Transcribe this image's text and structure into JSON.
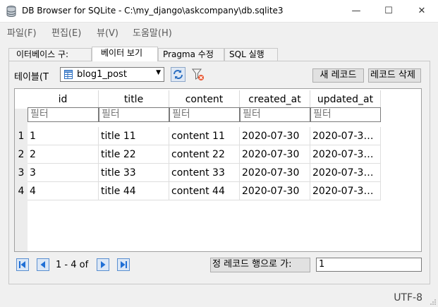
{
  "window": {
    "title": "DB Browser for SQLite - C:\\my_django\\askcompany\\db.sqlite3",
    "minimize": "—",
    "maximize": "☐",
    "close": "✕"
  },
  "menu": [
    "파일(F)",
    "편집(E)",
    "뷰(V)",
    "도움말(H)"
  ],
  "tabs": [
    "이터베이스 구:",
    "베이터 보기",
    "Pragma 수정",
    "SQL 실행"
  ],
  "browse": {
    "table_label": "테이블(T",
    "table_value": "blog1_post",
    "new_record": "새 레코드",
    "delete_record": "레코드 삭제",
    "columns": [
      "id",
      "title",
      "content",
      "created_at",
      "updated_at"
    ],
    "filter_placeholder": "필터",
    "rows": [
      {
        "num": "1",
        "cells": [
          "1",
          "title 11",
          "content 11",
          "2020-07-30",
          "2020-07-3…"
        ]
      },
      {
        "num": "2",
        "cells": [
          "2",
          "title 22",
          "content 22",
          "2020-07-30",
          "2020-07-3…"
        ]
      },
      {
        "num": "3",
        "cells": [
          "3",
          "title 33",
          "content 33",
          "2020-07-30",
          "2020-07-3…"
        ]
      },
      {
        "num": "4",
        "cells": [
          "4",
          "title 44",
          "content 44",
          "2020-07-30",
          "2020-07-3…"
        ]
      }
    ],
    "page_info": "1 - 4 of",
    "goto_label": "정 레코드 행으로 가:",
    "goto_value": "1"
  },
  "status": {
    "encoding": "UTF-8"
  },
  "colors": {
    "nav_blue": "#1f6fd6",
    "icon_blue": "#2c6fc1"
  }
}
